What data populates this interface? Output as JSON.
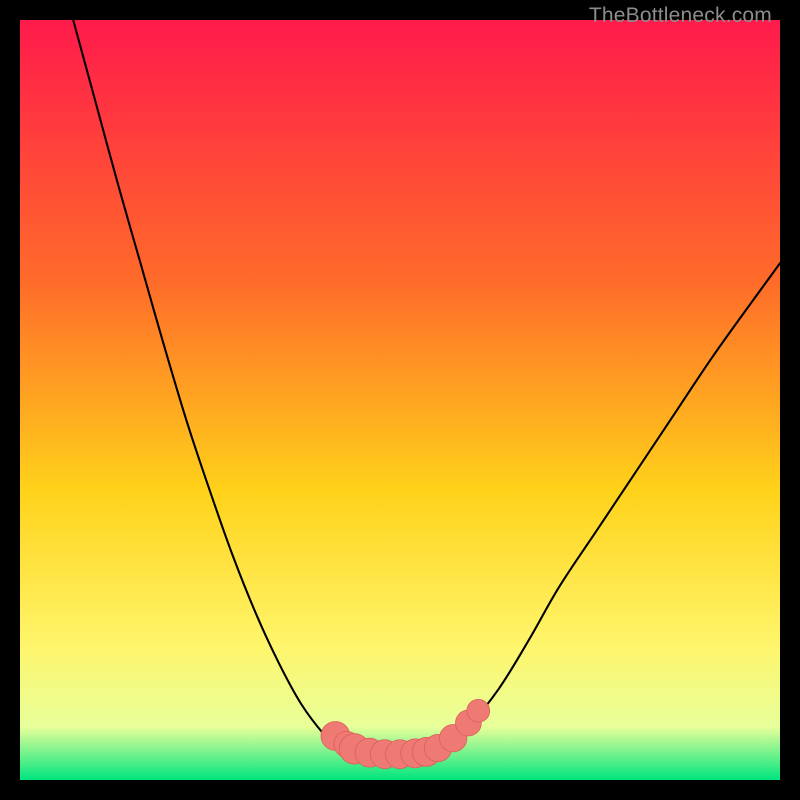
{
  "watermark": "TheBottleneck.com",
  "colors": {
    "frame": "#000000",
    "bg_top": "#ff1a4b",
    "bg_mid1": "#ff6a2a",
    "bg_mid2": "#ffd21a",
    "bg_mid3": "#fff56a",
    "bg_low": "#e8ff9a",
    "bg_bottom": "#00e57f",
    "curve": "#000000",
    "marker_fill": "#ef7a74",
    "marker_stroke": "#d85f5a"
  },
  "chart_data": {
    "type": "line",
    "title": "",
    "xlabel": "",
    "ylabel": "",
    "xlim": [
      0,
      100
    ],
    "ylim": [
      0,
      100
    ],
    "grid": false,
    "legend_position": "none",
    "series": [
      {
        "name": "left-branch",
        "x": [
          7,
          10,
          13,
          16,
          19,
          22,
          25,
          28,
          31,
          34,
          37,
          40,
          42
        ],
        "y": [
          100,
          89,
          78,
          67.5,
          57,
          47,
          38,
          29.5,
          22,
          15.5,
          10,
          6,
          4.2
        ]
      },
      {
        "name": "flat-bottom",
        "x": [
          42,
          45,
          48,
          51,
          54,
          56
        ],
        "y": [
          4.2,
          3.6,
          3.4,
          3.4,
          3.6,
          4.2
        ]
      },
      {
        "name": "right-branch",
        "x": [
          56,
          59,
          63,
          67,
          71,
          76,
          81,
          86,
          91,
          96,
          100
        ],
        "y": [
          4.2,
          7,
          12,
          18.5,
          25.5,
          33,
          40.5,
          48,
          55.5,
          62.5,
          68
        ]
      }
    ],
    "markers": {
      "name": "bottom-cluster",
      "points": [
        {
          "x": 41.5,
          "y": 5.8,
          "r": 1.9
        },
        {
          "x": 43.0,
          "y": 4.7,
          "r": 1.7
        },
        {
          "x": 44.0,
          "y": 4.1,
          "r": 2.0
        },
        {
          "x": 46.0,
          "y": 3.6,
          "r": 1.9
        },
        {
          "x": 48.0,
          "y": 3.4,
          "r": 1.9
        },
        {
          "x": 50.0,
          "y": 3.4,
          "r": 1.9
        },
        {
          "x": 52.0,
          "y": 3.5,
          "r": 1.9
        },
        {
          "x": 53.5,
          "y": 3.7,
          "r": 1.9
        },
        {
          "x": 55.0,
          "y": 4.2,
          "r": 1.8
        },
        {
          "x": 57.0,
          "y": 5.5,
          "r": 1.8
        },
        {
          "x": 59.0,
          "y": 7.5,
          "r": 1.7
        },
        {
          "x": 60.3,
          "y": 9.1,
          "r": 1.5
        }
      ]
    },
    "annotations": []
  }
}
